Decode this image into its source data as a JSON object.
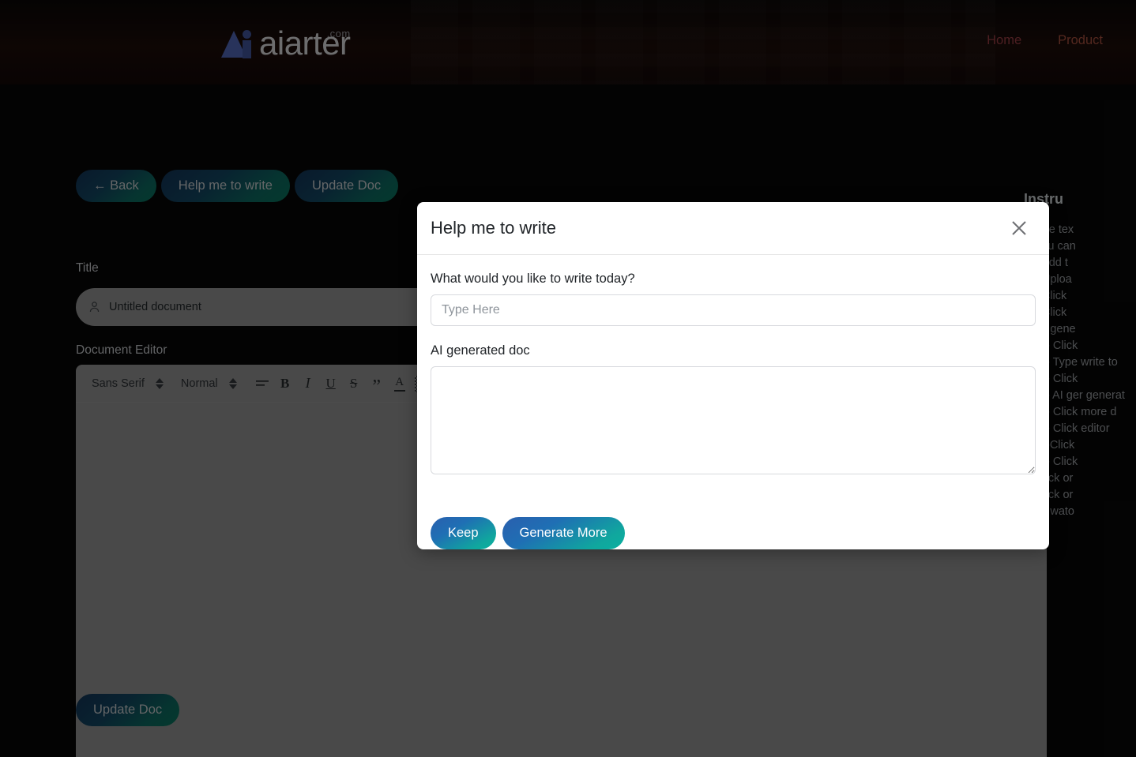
{
  "navbar": {
    "logo_text": "aiarter",
    "logo_suffix": ".com",
    "links": [
      {
        "label": "Home",
        "name": "nav-link-home"
      },
      {
        "label": "Product",
        "name": "nav-link-product"
      }
    ]
  },
  "toolbar_buttons": {
    "back": "← Back",
    "help_me_to_write": "Help me to write",
    "update_doc": "Update Doc"
  },
  "form": {
    "title_label": "Title",
    "title_value": "Untitled document",
    "editor_label": "Document Editor",
    "update_doc_bottom": "Update Doc"
  },
  "editor_toolbar": {
    "font_family": "Sans Serif",
    "font_size": "Normal",
    "align_icon": "align-icon",
    "bold": "B",
    "italic": "I",
    "underline": "U",
    "strikethrough": "S",
    "blockquote": "”",
    "text_color": "A",
    "highlight": "A"
  },
  "modal": {
    "title": "Help me to write",
    "close_icon": "close-icon",
    "prompt_label": "What would you like to write today?",
    "prompt_value": "",
    "prompt_placeholder": "Type Here",
    "output_label": "AI generated doc",
    "output_value": "",
    "keep_label": "Keep",
    "generate_more_label": "Generate More"
  },
  "instructions": {
    "title": "Instru",
    "items": [
      {
        "type": "circ",
        "text": "Use tex"
      },
      {
        "type": "circ",
        "text": "You can"
      },
      {
        "type": "disc",
        "text": "- Add t"
      },
      {
        "type": "disc",
        "text": "- Uploa"
      },
      {
        "type": "disc",
        "text": "- Click"
      },
      {
        "type": "disc",
        "text": "- Click"
      },
      {
        "type": "circ",
        "text": "To gene"
      },
      {
        "type": "sub",
        "text": "- Click"
      },
      {
        "type": "sub",
        "text": "- Type write to"
      },
      {
        "type": "sub",
        "text": "- Click"
      },
      {
        "type": "sub",
        "text": "- AI ger generat"
      },
      {
        "type": "sub",
        "text": "- Click more d"
      },
      {
        "type": "sub",
        "text": "- Click editor"
      },
      {
        "type": "sub",
        "text": "-Click"
      },
      {
        "type": "sub",
        "text": "- Click"
      },
      {
        "type": "circ",
        "text": "Click or"
      },
      {
        "type": "circ",
        "text": "Click or"
      },
      {
        "type": "circ",
        "text": "To wato"
      }
    ]
  },
  "colors": {
    "page_background": "#070707",
    "navbar_gradient_start": "#0a0706",
    "navbar_gradient_end": "#120807",
    "pill_gradient_start": "#123050",
    "pill_gradient_end": "#0a6b55",
    "modal_button_start": "#2a5fae",
    "modal_button_end": "#0bb0a0",
    "nav_link": "#8e3a3f",
    "surface_gray": "#878787",
    "modal_background": "#ffffff"
  }
}
